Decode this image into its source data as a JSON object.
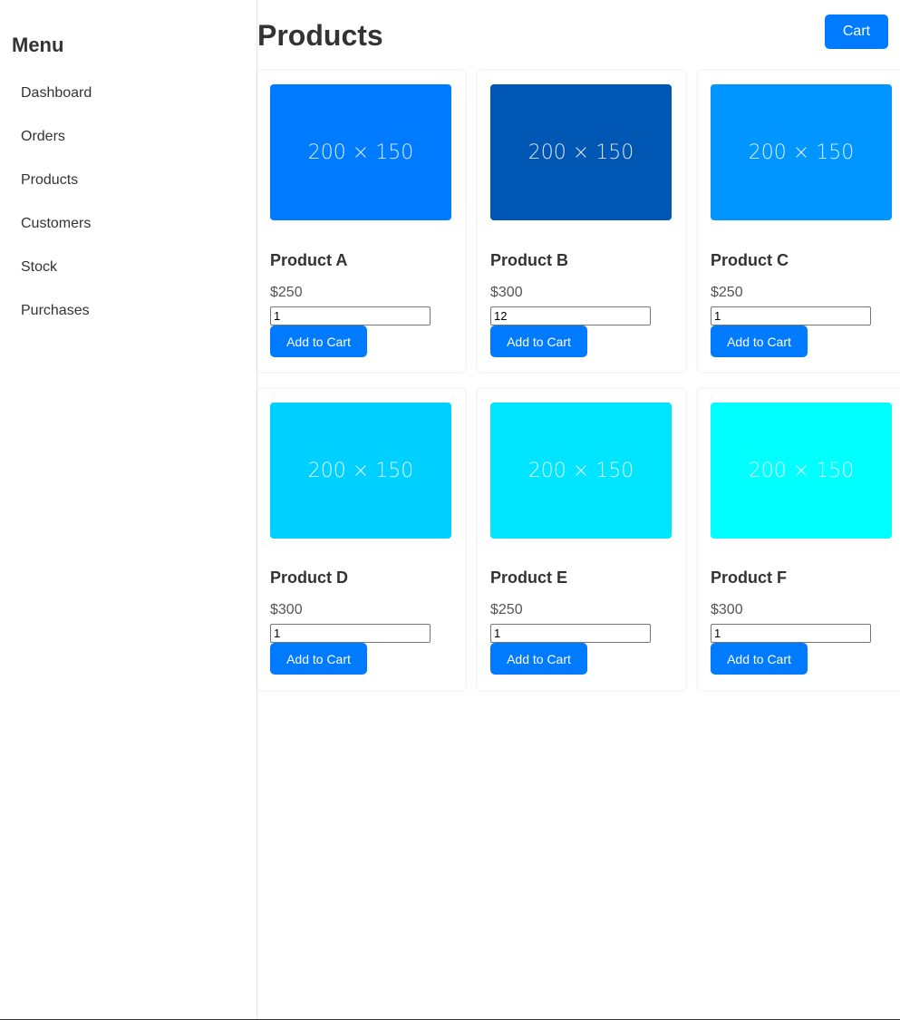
{
  "sidebar": {
    "title": "Menu",
    "items": [
      {
        "label": "Dashboard"
      },
      {
        "label": "Orders"
      },
      {
        "label": "Products"
      },
      {
        "label": "Customers"
      },
      {
        "label": "Stock"
      },
      {
        "label": "Purchases"
      }
    ]
  },
  "header": {
    "title": "Products",
    "cart_label": "Cart"
  },
  "products": [
    {
      "name": "Product A",
      "price": "$250",
      "qty": "1",
      "image_text": "200 × 150",
      "image_color": "#007bff",
      "button_label": "Add to Cart"
    },
    {
      "name": "Product B",
      "price": "$300",
      "qty": "12",
      "image_text": "200 × 150",
      "image_color": "#0056b3",
      "button_label": "Add to Cart"
    },
    {
      "name": "Product C",
      "price": "$250",
      "qty": "1",
      "image_text": "200 × 150",
      "image_color": "#0095ff",
      "button_label": "Add to Cart"
    },
    {
      "name": "Product D",
      "price": "$300",
      "qty": "1",
      "image_text": "200 × 150",
      "image_color": "#00d0ff",
      "button_label": "Add to Cart"
    },
    {
      "name": "Product E",
      "price": "$250",
      "qty": "1",
      "image_text": "200 × 150",
      "image_color": "#00e5ff",
      "button_label": "Add to Cart"
    },
    {
      "name": "Product F",
      "price": "$300",
      "qty": "1",
      "image_text": "200 × 150",
      "image_color": "#00ffff",
      "button_label": "Add to Cart"
    }
  ],
  "colors": {
    "accent": "#007bff"
  }
}
